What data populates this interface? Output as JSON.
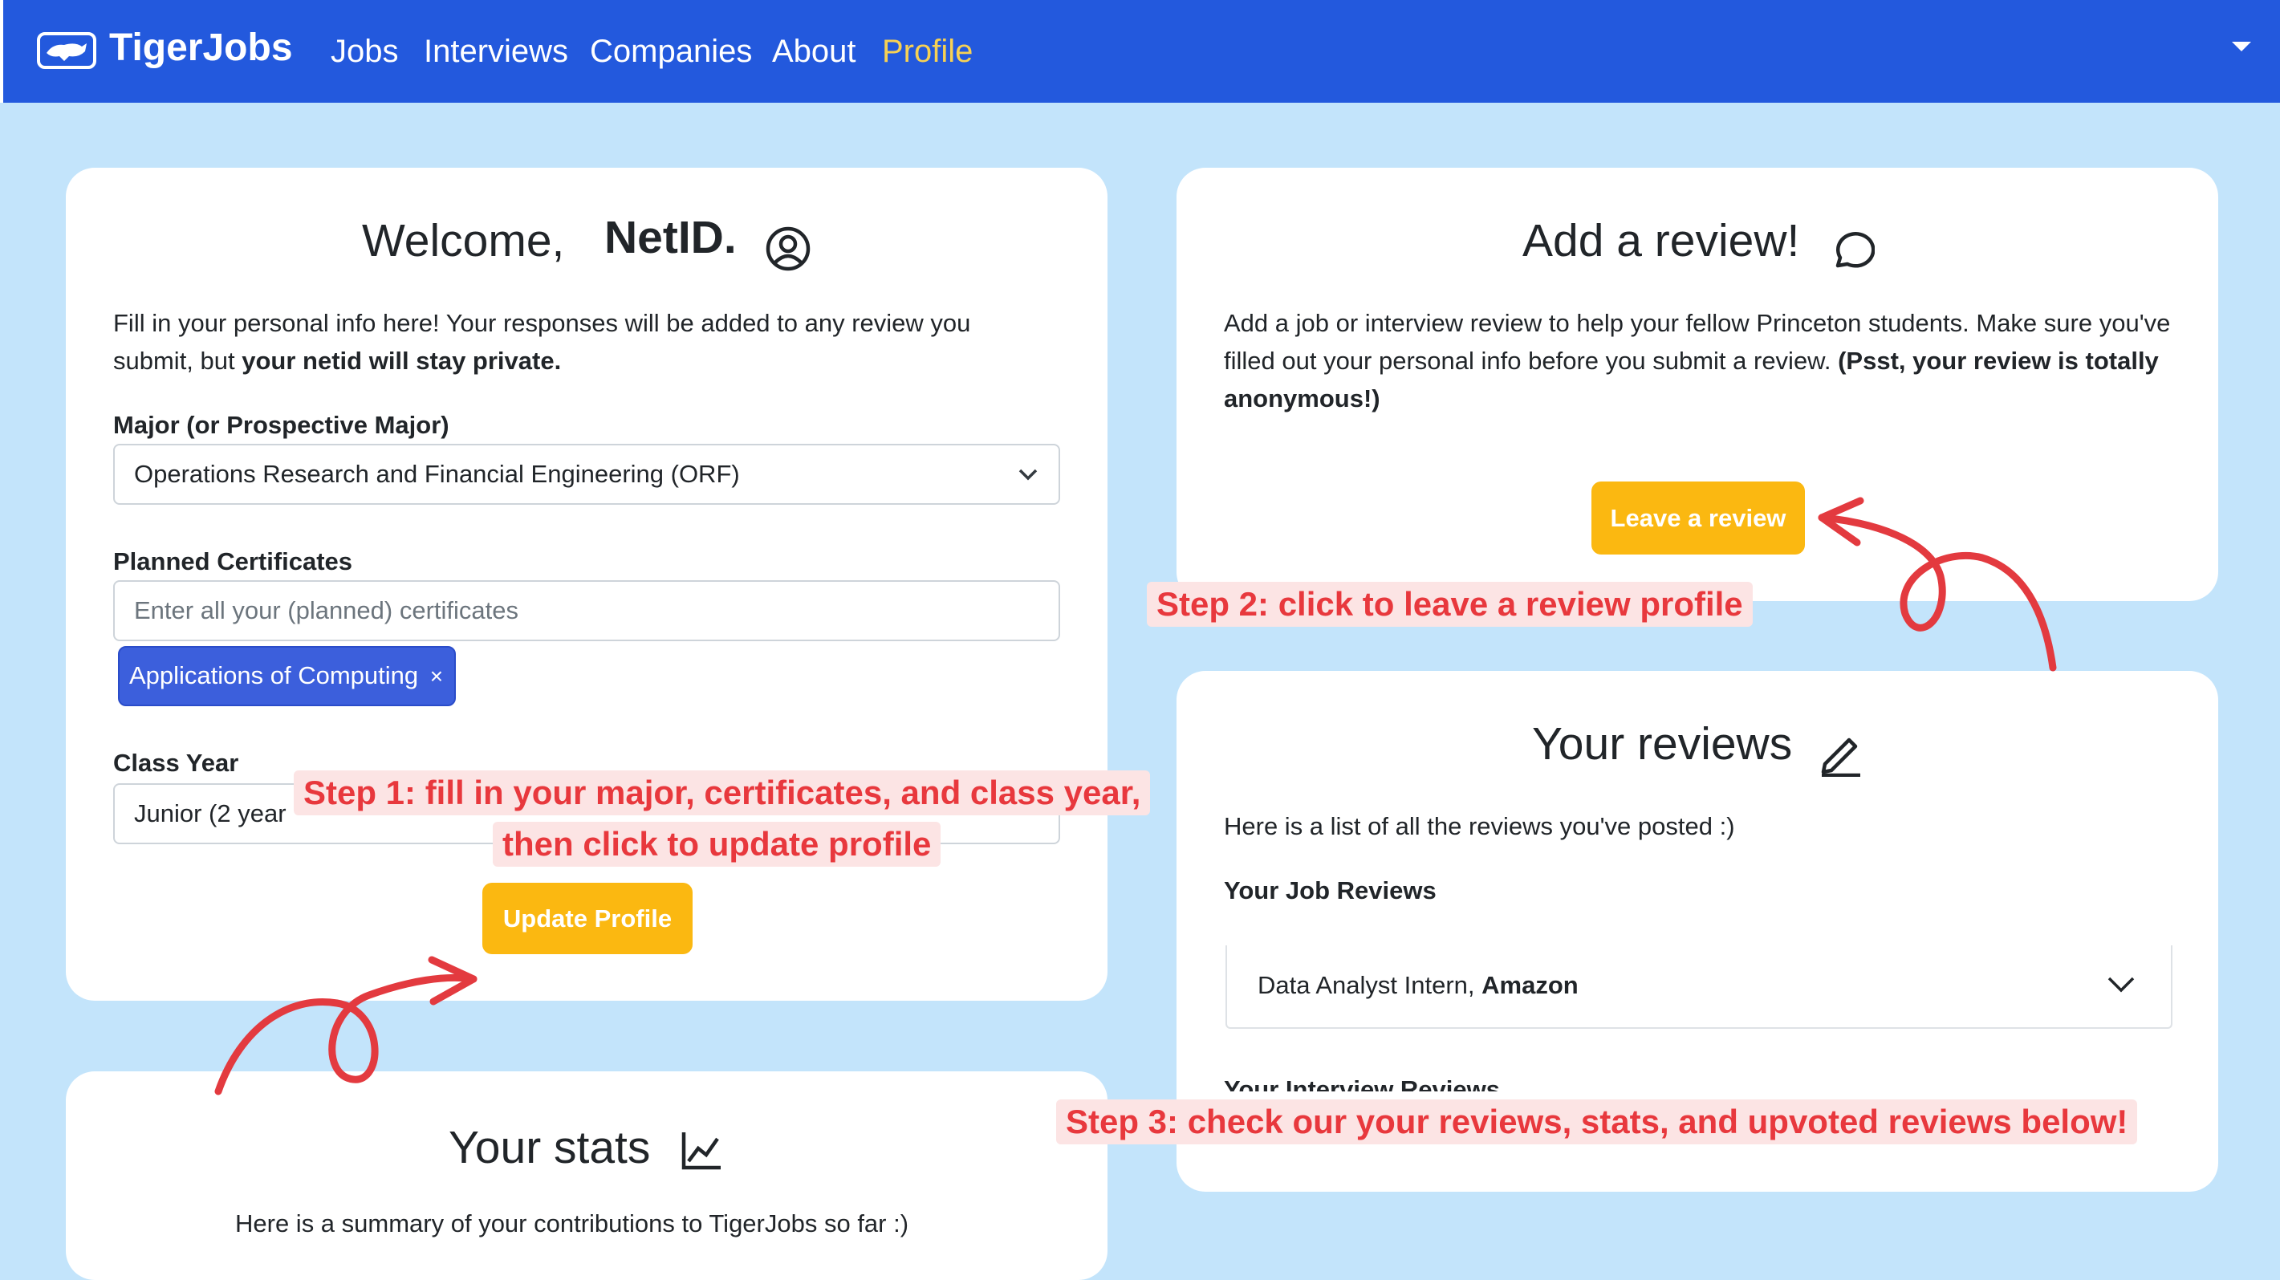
{
  "nav": {
    "brand": "TigerJobs",
    "links": [
      "Jobs",
      "Interviews",
      "Companies",
      "About",
      "Profile"
    ]
  },
  "welcome": {
    "greeting": "Welcome,",
    "netid": "NetID.",
    "intro": "Fill in your personal info here! Your responses will be added to any review you submit, but ",
    "intro_bold": "your netid will stay private.",
    "major_label": "Major (or Prospective Major)",
    "major_value": "Operations Research and Financial Engineering (ORF)",
    "cert_label": "Planned Certificates",
    "cert_placeholder": "Enter all your (planned) certificates",
    "cert_chip": "Applications of Computing",
    "chip_remove": "×",
    "year_label": "Class Year",
    "year_value": "Junior (2 year",
    "update_button": "Update Profile"
  },
  "add_review": {
    "title": "Add a review!",
    "text": "Add a job or interview review to help your fellow Princeton students. Make sure you've filled out your personal info before you submit a review. ",
    "text_bold": "(Psst, your review is totally anonymous!)",
    "button": "Leave a review"
  },
  "your_reviews": {
    "title": "Your reviews",
    "text": "Here is a list of all the reviews you've posted :)",
    "job_reviews_label": "Your Job Reviews",
    "job_item_role": "Data Analyst Intern,",
    "job_item_company": "Amazon",
    "interview_reviews_label": "Your Interview Reviews"
  },
  "stats": {
    "title": "Your stats",
    "text": "Here is a summary of your contributions to TigerJobs so far :)"
  },
  "annotations": {
    "step1_line1": "Step 1: fill in your major, certificates, and class year,",
    "step1_line2": "then click to update profile",
    "step2": "Step 2: click to leave a review profile",
    "step3": "Step 3: check our your reviews, stats, and upvoted reviews below!"
  },
  "colors": {
    "navbar": "#2359dd",
    "page_bg": "#c3e4fb",
    "active_link": "#f7d154",
    "button": "#fbb811",
    "chip": "#3c5fdc",
    "annotation_text": "#e8383d",
    "annotation_bg": "#fce4e4"
  }
}
